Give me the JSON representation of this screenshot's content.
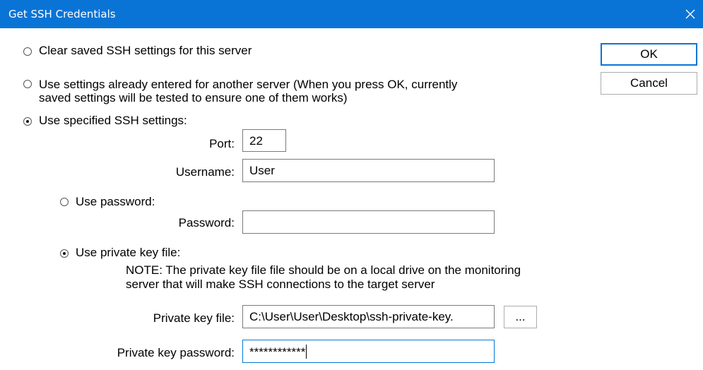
{
  "window": {
    "title": "Get SSH Credentials",
    "close_icon": "close-icon",
    "titlebar_color": "#0a74d6"
  },
  "options": {
    "clear": {
      "label": "Clear saved SSH settings for this server",
      "selected": false
    },
    "other_server": {
      "line1": "Use settings already entered for another server (When you press OK, currently",
      "line2": "saved settings will be tested to ensure one of them works)",
      "selected": false
    },
    "specified": {
      "label": "Use specified SSH settings:",
      "selected": true
    }
  },
  "fields": {
    "port": {
      "label": "Port:",
      "value": "22"
    },
    "username": {
      "label": "Username:",
      "value": "User"
    },
    "password": {
      "label": "Password:",
      "value": ""
    },
    "private_key_file": {
      "label": "Private key file:",
      "value": "C:\\User\\User\\Desktop\\ssh-private-key."
    },
    "private_key_password": {
      "label": "Private key password:",
      "value": "************"
    }
  },
  "auth": {
    "use_password": {
      "label": "Use password:",
      "selected": false
    },
    "use_key": {
      "label": "Use private key file:",
      "selected": true
    },
    "note_line1": "NOTE: The private key file file should be on a local drive on the monitoring",
    "note_line2": "server that will make SSH connections to the target server"
  },
  "buttons": {
    "ok": "OK",
    "cancel": "Cancel",
    "browse": "..."
  }
}
